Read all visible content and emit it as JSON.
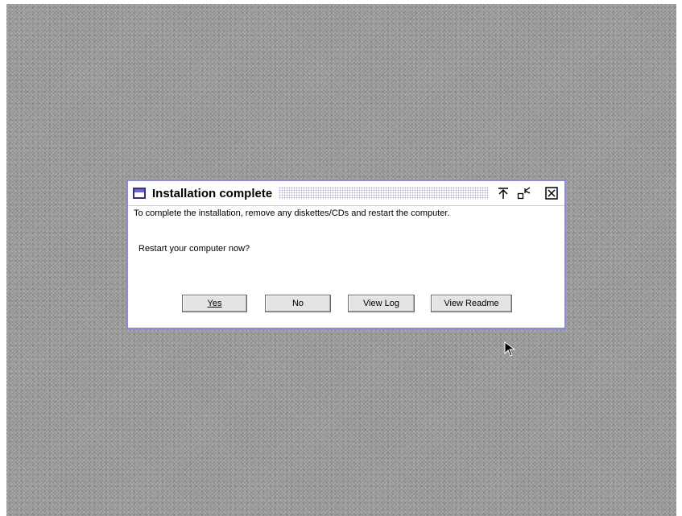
{
  "dialog": {
    "title": "Installation complete",
    "message": "To complete the installation, remove any diskettes/CDs and restart the computer.",
    "question": "Restart your computer now?",
    "titlebar_icons": [
      "window-menu-icon",
      "move-to-top-icon",
      "restore-icon",
      "close-icon"
    ],
    "buttons": {
      "yes": "Yes",
      "no": "No",
      "view_log": "View Log",
      "view_readme": "View Readme"
    }
  },
  "colors": {
    "title_border": "#8a8ad8",
    "desktop": "#9a9a9a",
    "button_face": "#e4e4e4"
  }
}
